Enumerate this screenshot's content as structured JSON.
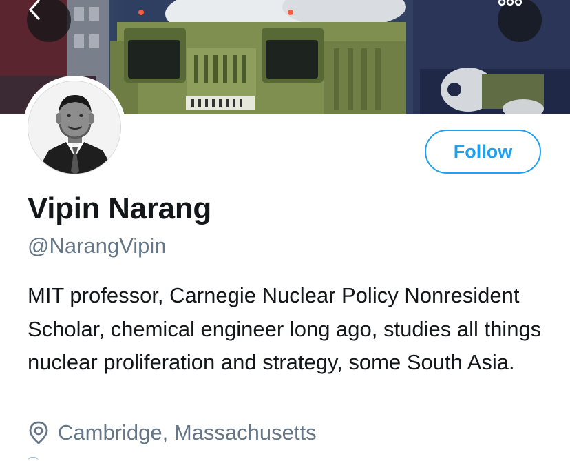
{
  "header": {
    "back_icon": "chevron-left-icon",
    "more_icon": "ellipsis-icon",
    "banner_image": "military-vehicle-missile-parade",
    "banner_colors": {
      "vehicle": "#8a9a5b",
      "sky": "#2f3f62",
      "accent": "#7b3340"
    }
  },
  "profile": {
    "avatar_image": "portrait-photo",
    "follow_label": "Follow",
    "display_name": "Vipin Narang",
    "handle": "@NarangVipin",
    "bio": "MIT professor, Carnegie Nuclear Policy Nonresident Scholar, chemical engineer long ago, studies all things nuclear proliferation and strategy, some South Asia.",
    "location_icon": "location-pin-icon",
    "location": "Cambridge, Massachusetts"
  },
  "colors": {
    "accent": "#1da1f2",
    "text_primary": "#14171a",
    "text_secondary": "#657786",
    "overlay_button": "#14171a"
  }
}
